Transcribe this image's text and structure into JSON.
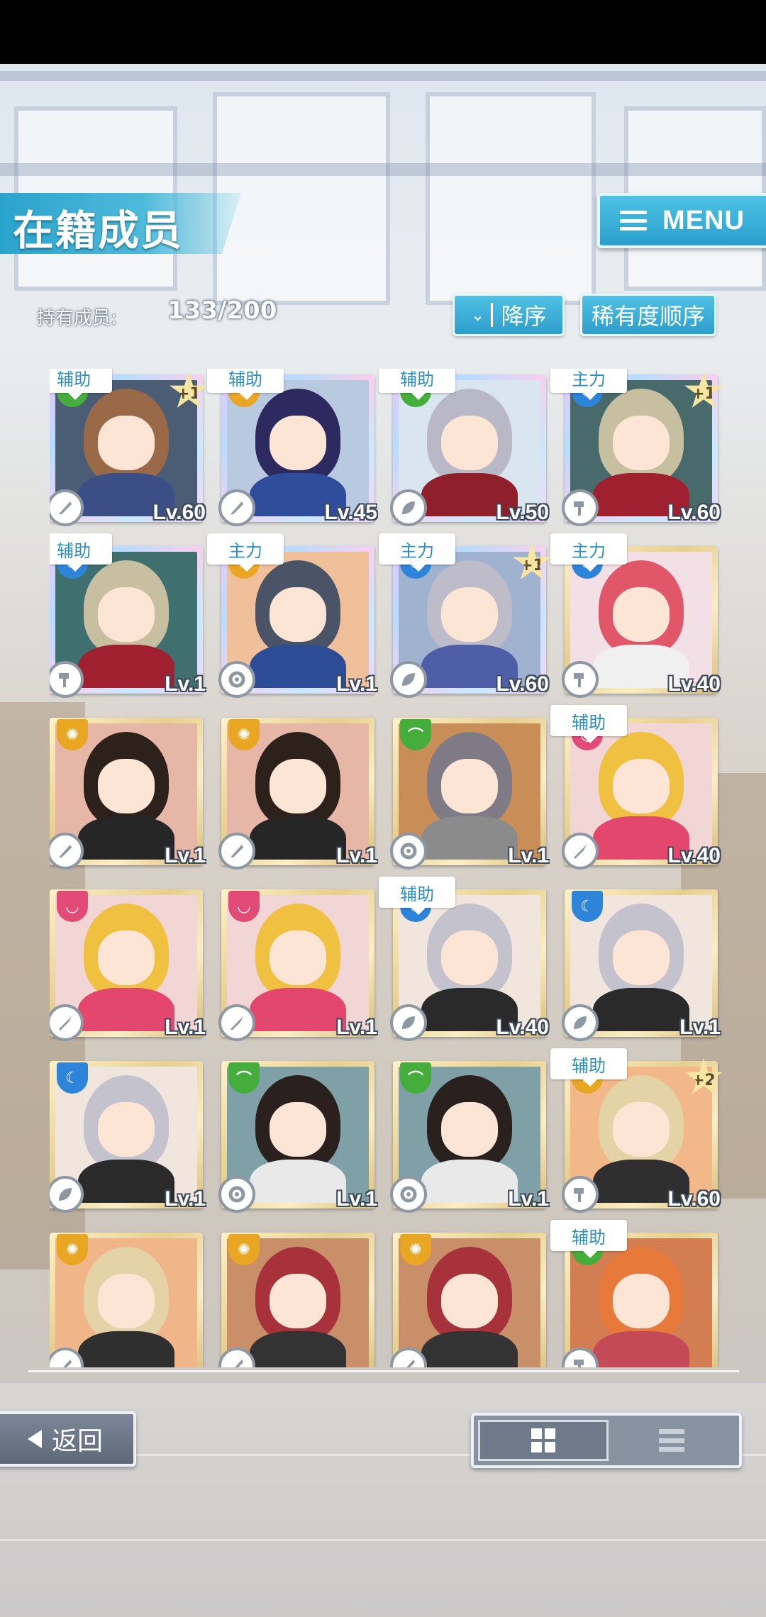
{
  "header": {
    "title": "在籍成员",
    "menu_label": "MENU"
  },
  "members": {
    "label": "持有成员:",
    "count": "133/200"
  },
  "sort": {
    "order_label": "降序",
    "rarity_label": "稀有度顺序"
  },
  "cards": [
    {
      "tag": "辅助",
      "attr": "green",
      "frame": "rainbow",
      "plus": "+1",
      "level": "Lv.60",
      "skill": "feather-icon",
      "hair": "#9a6a48",
      "body": "#3b4f86",
      "bg": "#4a5d74"
    },
    {
      "tag": "辅助",
      "attr": "yellow",
      "frame": "rainbow",
      "plus": "",
      "level": "Lv.45",
      "skill": "feather-icon",
      "hair": "#2c2a5e",
      "body": "#2f4d9a",
      "bg": "#b9c9df"
    },
    {
      "tag": "辅助",
      "attr": "green",
      "frame": "rainbow",
      "plus": "",
      "level": "Lv.50",
      "skill": "leaf-icon",
      "hair": "#b9b8c6",
      "body": "#8e1f2b",
      "bg": "#d9e6f0"
    },
    {
      "tag": "主力",
      "attr": "blue",
      "frame": "rainbow",
      "plus": "+1",
      "level": "Lv.60",
      "skill": "hammer-icon",
      "hair": "#c7c0a0",
      "body": "#a02030",
      "bg": "#486a6b"
    },
    {
      "tag": "辅助",
      "attr": "blue",
      "frame": "rainbow",
      "plus": "",
      "level": "Lv.1",
      "skill": "hammer-icon",
      "hair": "#c7c0a0",
      "body": "#a02030",
      "bg": "#3f6f6e"
    },
    {
      "tag": "主力",
      "attr": "yellow",
      "frame": "rainbow",
      "plus": "",
      "level": "Lv.1",
      "skill": "gear-icon",
      "hair": "#4a5466",
      "body": "#2d4c96",
      "bg": "#f0c09a"
    },
    {
      "tag": "主力",
      "attr": "blue",
      "frame": "rainbow",
      "plus": "+1",
      "level": "Lv.60",
      "skill": "leaf-icon",
      "hair": "#bdbcc8",
      "body": "#4e5fa8",
      "bg": "#9fb3d1"
    },
    {
      "tag": "主力",
      "attr": "blue",
      "frame": "gold",
      "plus": "",
      "level": "Lv.40",
      "skill": "hammer-icon",
      "hair": "#e2566a",
      "body": "#f0f0f0",
      "bg": "#f3e0e6"
    },
    {
      "tag": "",
      "attr": "yellow",
      "frame": "gold",
      "plus": "",
      "level": "Lv.1",
      "skill": "feather-icon",
      "hair": "#2d211c",
      "body": "#262626",
      "bg": "#e6b7a6"
    },
    {
      "tag": "",
      "attr": "yellow",
      "frame": "gold",
      "plus": "",
      "level": "Lv.1",
      "skill": "feather-icon",
      "hair": "#2d211c",
      "body": "#262626",
      "bg": "#e6b7a6"
    },
    {
      "tag": "",
      "attr": "green",
      "frame": "gold",
      "plus": "",
      "level": "Lv.1",
      "skill": "gear-icon",
      "hair": "#7f7b86",
      "body": "#8b8b8b",
      "bg": "#c98d58"
    },
    {
      "tag": "辅助",
      "attr": "pink",
      "frame": "gold",
      "plus": "",
      "level": "Lv.40",
      "skill": "sword-icon",
      "hair": "#f0c040",
      "body": "#e3476e",
      "bg": "#f2d6d6"
    },
    {
      "tag": "",
      "attr": "pink",
      "frame": "gold",
      "plus": "",
      "level": "Lv.1",
      "skill": "sword-icon",
      "hair": "#f0c040",
      "body": "#e3476e",
      "bg": "#f2d6d6"
    },
    {
      "tag": "",
      "attr": "pink",
      "frame": "gold",
      "plus": "",
      "level": "Lv.1",
      "skill": "sword-icon",
      "hair": "#f0c040",
      "body": "#e3476e",
      "bg": "#f2d6d6"
    },
    {
      "tag": "辅助",
      "attr": "blue",
      "frame": "gold",
      "plus": "",
      "level": "Lv.40",
      "skill": "leaf-icon",
      "hair": "#c4c2cc",
      "body": "#2a2a2a",
      "bg": "#f1e6de"
    },
    {
      "tag": "",
      "attr": "blue",
      "frame": "gold",
      "plus": "",
      "level": "Lv.1",
      "skill": "leaf-icon",
      "hair": "#c4c2cc",
      "body": "#2a2a2a",
      "bg": "#f1e6de"
    },
    {
      "tag": "",
      "attr": "blue",
      "frame": "gold",
      "plus": "",
      "level": "Lv.1",
      "skill": "leaf-icon",
      "hair": "#c4c2cc",
      "body": "#2a2a2a",
      "bg": "#f1e6de"
    },
    {
      "tag": "",
      "attr": "green",
      "frame": "gold",
      "plus": "",
      "level": "Lv.1",
      "skill": "gear-icon",
      "hair": "#2a211e",
      "body": "#e9e9e9",
      "bg": "#7fa0a6"
    },
    {
      "tag": "",
      "attr": "green",
      "frame": "gold",
      "plus": "",
      "level": "Lv.1",
      "skill": "gear-icon",
      "hair": "#2a211e",
      "body": "#e9e9e9",
      "bg": "#7fa0a6"
    },
    {
      "tag": "辅助",
      "attr": "yellow",
      "frame": "gold",
      "plus": "+2",
      "level": "Lv.60",
      "skill": "hammer-icon",
      "hair": "#e4d3a6",
      "body": "#2f2f2f",
      "bg": "#f3b889"
    },
    {
      "tag": "",
      "attr": "yellow",
      "frame": "gold",
      "plus": "",
      "level": "",
      "skill": "feather-icon",
      "hair": "#e4d3a6",
      "body": "#2f2f2f",
      "bg": "#f1b58a"
    },
    {
      "tag": "",
      "attr": "yellow",
      "frame": "gold",
      "plus": "",
      "level": "",
      "skill": "feather-icon",
      "hair": "#a8323c",
      "body": "#333333",
      "bg": "#c98f68"
    },
    {
      "tag": "",
      "attr": "yellow",
      "frame": "gold",
      "plus": "",
      "level": "",
      "skill": "feather-icon",
      "hair": "#a8323c",
      "body": "#333333",
      "bg": "#c98f68"
    },
    {
      "tag": "辅助",
      "attr": "green",
      "frame": "gold",
      "plus": "",
      "level": "",
      "skill": "hammer-icon",
      "hair": "#e77a3a",
      "body": "#c44a58",
      "bg": "#d27e52"
    }
  ],
  "footer": {
    "back_label": "返回",
    "view_grid_icon": "grid-icon",
    "view_list_icon": "list-icon"
  }
}
